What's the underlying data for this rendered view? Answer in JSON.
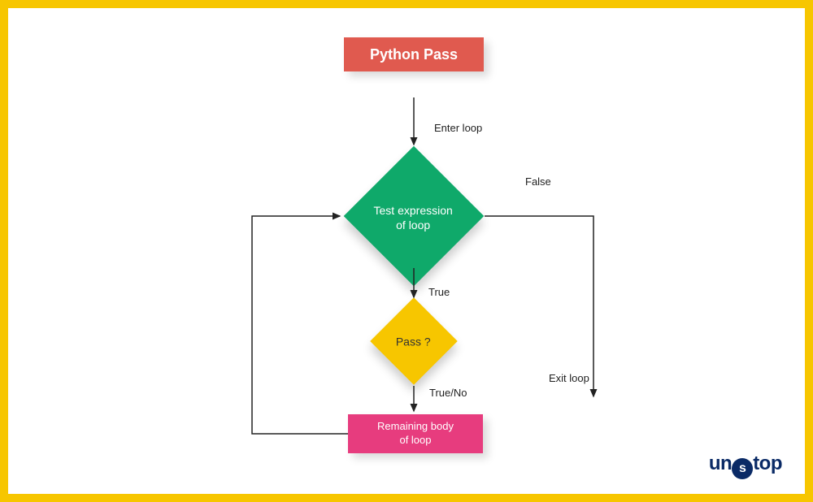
{
  "title": "Python Pass",
  "nodes": {
    "test_expression": {
      "type": "decision",
      "text_line1": "Test expression",
      "text_line2": "of loop",
      "color": "#0fa96a"
    },
    "pass_check": {
      "type": "decision",
      "text": "Pass ?",
      "color": "#f7c600"
    },
    "remaining_body": {
      "type": "process",
      "text_line1": "Remaining body",
      "text_line2": "of loop",
      "color": "#e73c7e"
    }
  },
  "edges": {
    "enter_loop": "Enter loop",
    "test_false": "False",
    "test_true": "True",
    "pass_result": "True/No",
    "exit_loop": "Exit loop"
  },
  "brand": {
    "name": "unstop",
    "prefix": "un",
    "suffix": "top",
    "accent_char": "s",
    "color": "#0a2a66"
  },
  "colors": {
    "frame": "#f7c600",
    "canvas": "#ffffff",
    "title_bg": "#e05a4f",
    "green": "#0fa96a",
    "yellow": "#f7c600",
    "pink": "#e73c7e"
  }
}
